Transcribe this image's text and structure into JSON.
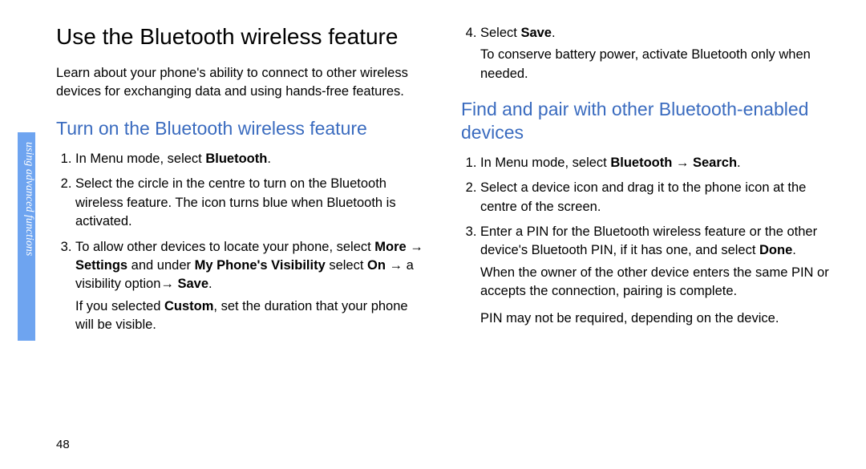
{
  "side_tab": "using advanced functions",
  "page_number": "48",
  "left": {
    "title": "Use the Bluetooth wireless feature",
    "intro": "Learn about your phone's ability to connect to other wireless devices for exchanging data and using hands-free features.",
    "sub1": "Turn on the Bluetooth wireless feature",
    "step1_pre": "In Menu mode, select ",
    "step1_b1": "Bluetooth",
    "step1_post": ".",
    "step2": "Select the circle in the centre to turn on the Bluetooth wireless feature. The icon turns blue when Bluetooth is activated.",
    "step3_a": "To allow other devices to locate your phone, select ",
    "step3_b1": "More",
    "step3_c": " → ",
    "step3_b2": "Settings",
    "step3_d": " and under ",
    "step3_b3": "My Phone's Visibility",
    "step3_e": " select ",
    "step3_b4": "On",
    "step3_f": " → a visibility option→ ",
    "step3_b5": "Save",
    "step3_g": ".",
    "step3_note_a": "If you selected ",
    "step3_note_b": "Custom",
    "step3_note_c": ", set the duration that your phone will be visible."
  },
  "right": {
    "step4_a": "Select ",
    "step4_b": "Save",
    "step4_c": ".",
    "step4_note": "To conserve battery power, activate Bluetooth only when needed.",
    "sub2": "Find and pair with other Bluetooth-enabled devices",
    "r_step1_a": "In Menu mode, select ",
    "r_step1_b1": "Bluetooth",
    "r_step1_c": " → ",
    "r_step1_b2": "Search",
    "r_step1_d": ".",
    "r_step2": "Select a device icon and drag it to the phone icon at the centre of the screen.",
    "r_step3_a": "Enter a PIN for the Bluetooth wireless feature or the other device's Bluetooth PIN, if it has one, and select ",
    "r_step3_b": "Done",
    "r_step3_c": ".",
    "r_step3_note1": "When the owner of the other device enters the same PIN or accepts the connection, pairing is complete.",
    "r_step3_note2": "PIN may not be required, depending on the device."
  }
}
